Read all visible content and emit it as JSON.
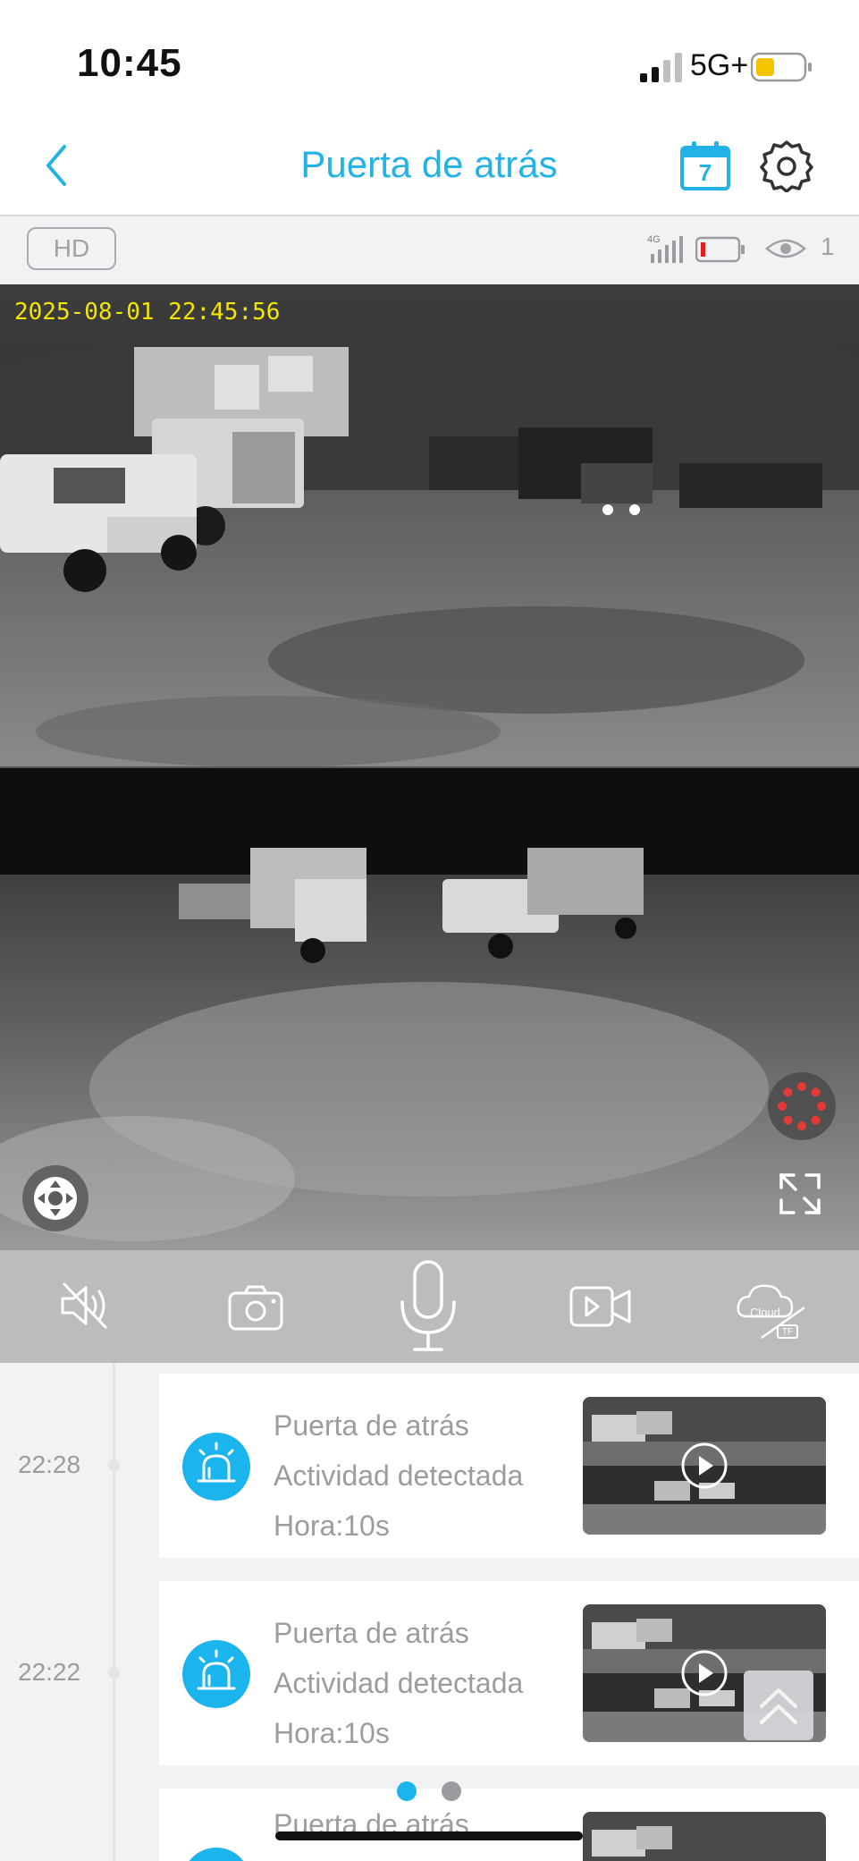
{
  "status_bar": {
    "time": "10:45",
    "network": "5G+"
  },
  "nav": {
    "title": "Puerta de atrás",
    "calendar_day": "7"
  },
  "info_bar": {
    "quality": "HD",
    "signal_type": "4G",
    "viewers": "1"
  },
  "video": {
    "timestamp": "2025-08-01  22:45:56"
  },
  "controls": {
    "cloud_label": "Cloud",
    "tf_label": "TF"
  },
  "events": [
    {
      "time": "22:28",
      "camera": "Puerta de atrás",
      "activity": "Actividad detectada",
      "duration": "Hora:10s"
    },
    {
      "time": "22:22",
      "camera": "Puerta de atrás",
      "activity": "Actividad detectada",
      "duration": "Hora:10s"
    },
    {
      "time": "",
      "camera": "Puerta de atrás",
      "activity": "",
      "duration": ""
    }
  ],
  "colors": {
    "accent": "#23b2e6",
    "alarm": "#1bb4ec",
    "timestamp": "#f3e600",
    "record": "#e53935",
    "battery_fill": "#f5c400",
    "low_battery": "#e02020"
  },
  "pager": {
    "active": 0,
    "count": 2
  }
}
